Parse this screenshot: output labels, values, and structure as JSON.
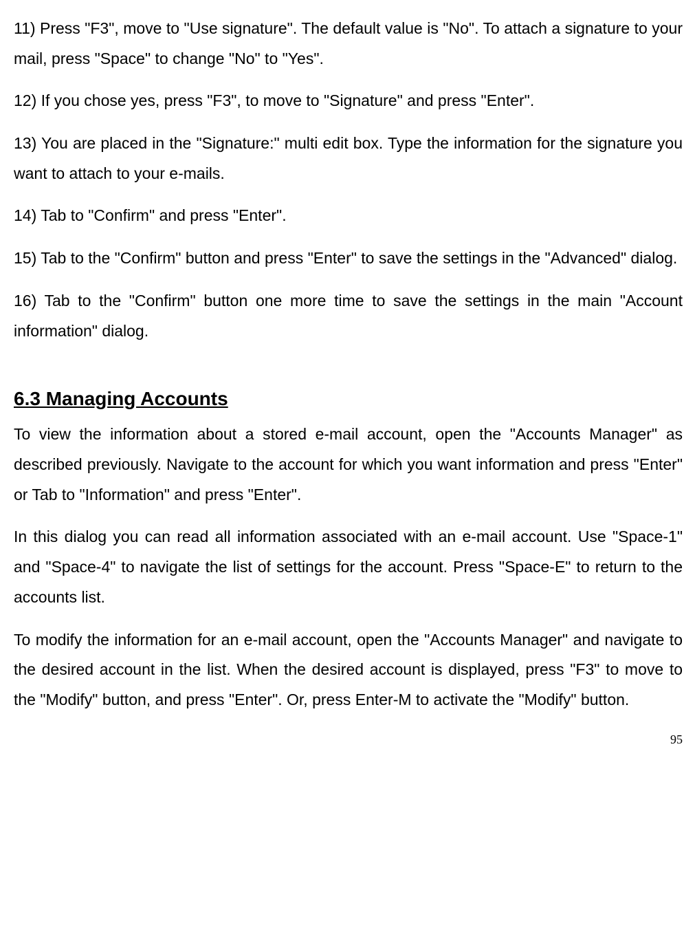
{
  "paragraphs": {
    "p11": "11) Press \"F3\", move to \"Use signature\". The default value is \"No\". To attach a signature to your mail, press \"Space\" to change \"No\" to \"Yes\".",
    "p12": "12) If you chose yes, press \"F3\", to move to \"Signature\" and press \"Enter\".",
    "p13": "13) You are placed in the \"Signature:\" multi edit box. Type the information for the signature you want to attach to your e-mails.",
    "p14": "14) Tab to \"Confirm\" and press \"Enter\".",
    "p15": "15) Tab to the \"Confirm\" button and press \"Enter\" to save the settings in the \"Advanced\" dialog.",
    "p16": "16) Tab to the \"Confirm\" button one more time to save the settings in the main \"Account information\" dialog."
  },
  "section": {
    "heading": "6.3 Managing Accounts",
    "body1": "To view the information about a stored e-mail account, open the \"Accounts Manager\" as described previously. Navigate to the account for which you want information and press \"Enter\" or Tab to \"Information\" and press \"Enter\".",
    "body2": "In this dialog you can read all information associated with an e-mail account. Use \"Space-1\" and \"Space-4\" to navigate the list of settings for the account. Press \"Space-E\" to return to the accounts list.",
    "body3": "To modify the information for an e-mail account, open the \"Accounts Manager\" and navigate to the desired account in the list. When the desired account is displayed, press \"F3\" to move to the \"Modify\" button, and press \"Enter\". Or, press Enter-M to activate the \"Modify\" button."
  },
  "page_number": "95"
}
